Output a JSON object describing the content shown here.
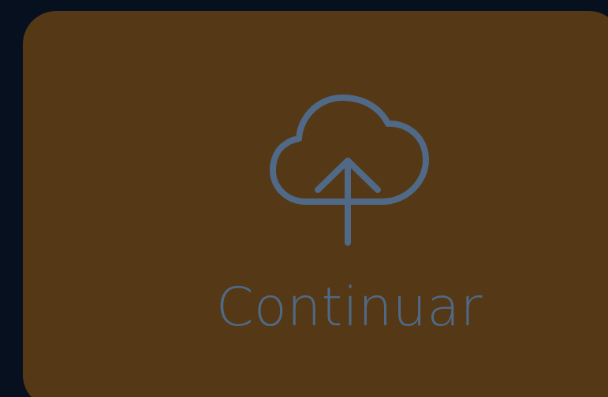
{
  "button": {
    "label": "Continuar",
    "icon": "cloud-upload-icon"
  },
  "colors": {
    "page_background": "#07101f",
    "card_background": "#553816",
    "accent": "#4f6987"
  }
}
